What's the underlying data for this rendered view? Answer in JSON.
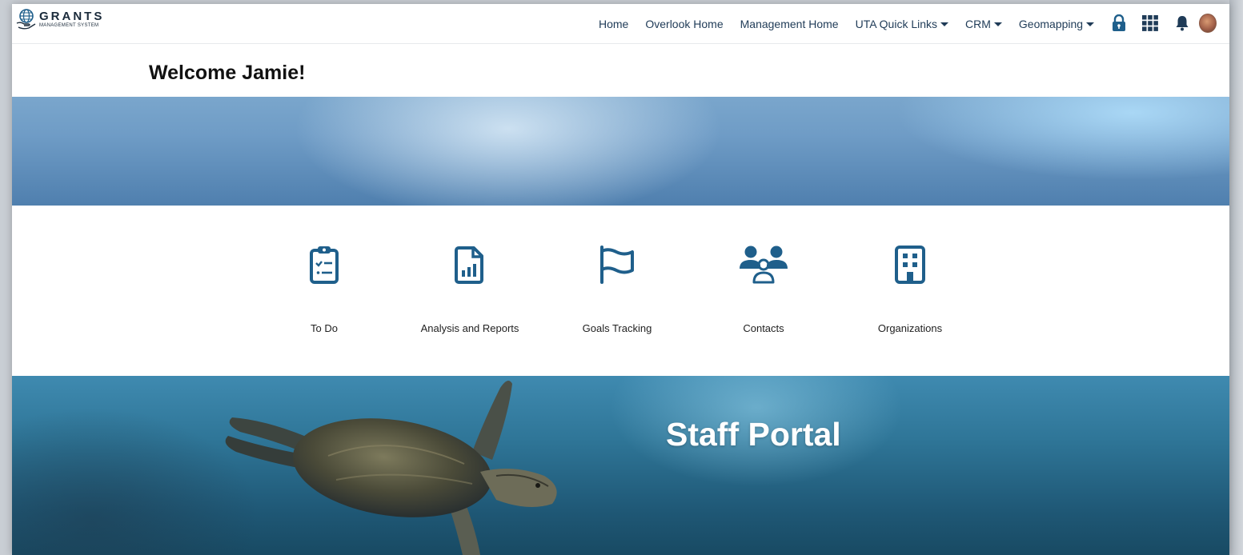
{
  "app": {
    "logo_main": "GRANTS",
    "logo_sub": "MANAGEMENT SYSTEM"
  },
  "nav": {
    "links": [
      {
        "label": "Home",
        "dropdown": false
      },
      {
        "label": "Overlook Home",
        "dropdown": false
      },
      {
        "label": "Management Home",
        "dropdown": false
      },
      {
        "label": "UTA Quick Links",
        "dropdown": true
      },
      {
        "label": "CRM",
        "dropdown": true
      },
      {
        "label": "Geomapping",
        "dropdown": true
      }
    ],
    "icons": [
      "lock-icon",
      "apps-grid-icon",
      "bell-icon",
      "user-avatar"
    ]
  },
  "welcome": {
    "text": "Welcome Jamie!"
  },
  "tiles": [
    {
      "label": "To Do",
      "icon": "clipboard-checklist-icon"
    },
    {
      "label": "Analysis and Reports",
      "icon": "report-chart-icon"
    },
    {
      "label": "Goals Tracking",
      "icon": "flag-icon"
    },
    {
      "label": "Contacts",
      "icon": "contacts-group-icon"
    },
    {
      "label": "Organizations",
      "icon": "building-icon"
    }
  ],
  "hero": {
    "title": "Staff Portal"
  },
  "colors": {
    "accent": "#1f5f8b",
    "nav_text": "#1f3b57",
    "hero_text": "#ffffff"
  }
}
